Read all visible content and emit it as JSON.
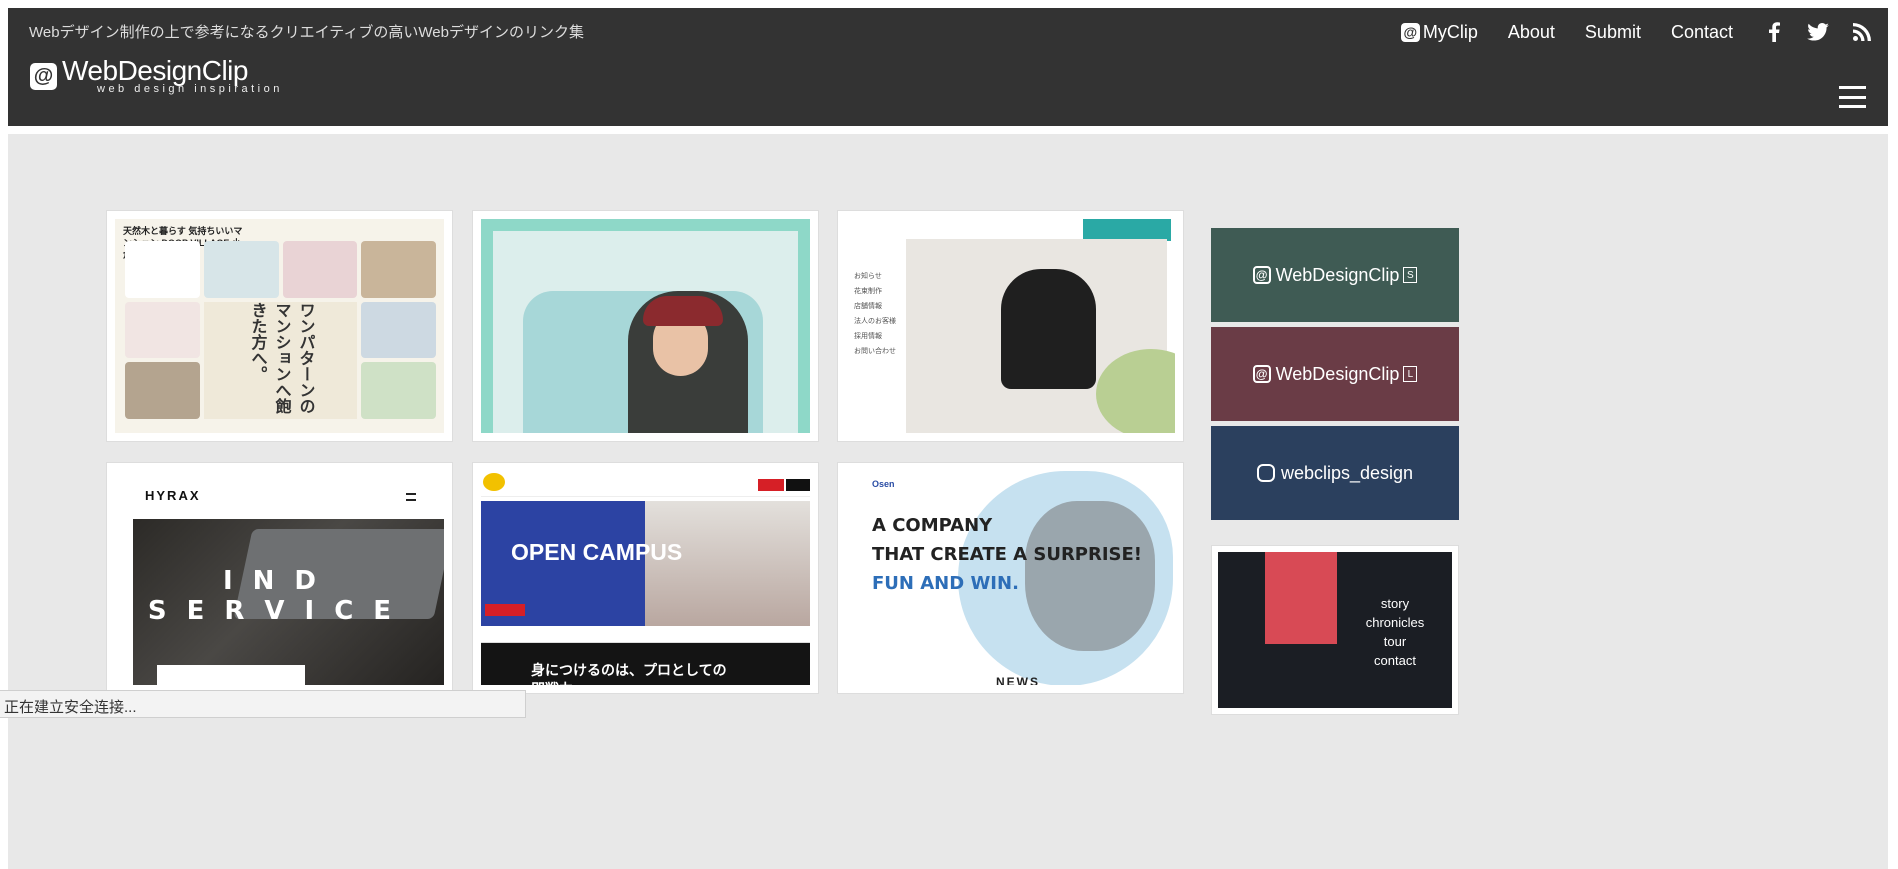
{
  "header": {
    "tagline": "Webデザイン制作の上で参考になるクリエイティブの高いWebデザインのリンク集",
    "logo_name": "WebDesignClip",
    "logo_sub": "web design inspiration",
    "nav": {
      "myclip": "MyClip",
      "about": "About",
      "submit": "Submit",
      "contact": "Contact"
    },
    "social_icons": [
      "facebook-icon",
      "twitter-icon",
      "rss-icon"
    ]
  },
  "cards": {
    "c1": {
      "title": "天然木と暮らす 気持ちいいマンション DOOP VILLAGE 小倉",
      "center": "ワンパターンのマンションへ飽きた方へ。"
    },
    "c3": {
      "menu": [
        "お知らせ",
        "花束制作",
        "店舗情報",
        "法人のお客様",
        "採用情報",
        "お問い合わせ"
      ]
    },
    "c4": {
      "brand": "HYRAX",
      "headline": "IND SERVICE"
    },
    "c5": {
      "headline": "OPEN CAMPUS",
      "sub": "身につけるのは、プロとしての即戦力。"
    },
    "c6": {
      "logo": "Osen",
      "line1": "A COMPANY",
      "line2": "THAT CREATE A SURPRISE!",
      "line3": "FUN AND WIN.",
      "news": "NEWS"
    }
  },
  "sidebar": {
    "banner1": {
      "label": "WebDesignClip",
      "badge": "S",
      "color": "#3f5b54"
    },
    "banner2": {
      "label": "WebDesignClip",
      "badge": "L",
      "color": "#6a3c46"
    },
    "banner3": {
      "label": "webclips_design",
      "color": "#2b405e"
    },
    "ad_links": [
      "story",
      "chronicles",
      "tour",
      "contact"
    ]
  },
  "status_text": "正在建立安全连接..."
}
